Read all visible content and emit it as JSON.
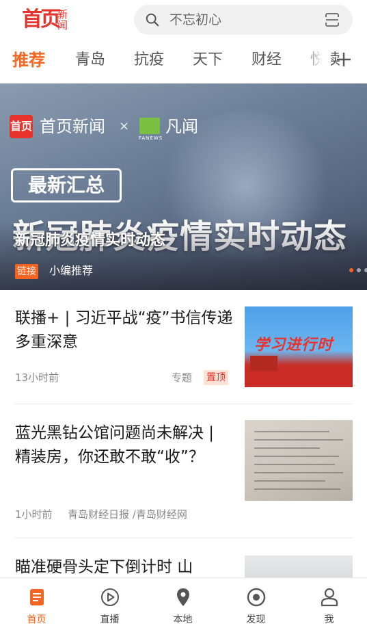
{
  "header": {
    "logo_main": "首页",
    "logo_side": "新闻",
    "search_placeholder": "不忘初心"
  },
  "tabs": [
    {
      "label": "推荐",
      "active": true
    },
    {
      "label": "青岛",
      "active": false
    },
    {
      "label": "抗疫",
      "active": false
    },
    {
      "label": "天下",
      "active": false
    },
    {
      "label": "财经",
      "active": false
    },
    {
      "label": "悦读",
      "active": false
    }
  ],
  "banner": {
    "brand": "首页新闻",
    "logo_mark": "首页",
    "times": "×",
    "partner": "凡闻",
    "partner_sub": "FANEWS",
    "badge": "最新汇总",
    "headline": "新冠肺炎疫情实时动态",
    "tag": "链接",
    "source": "小编推荐",
    "slide_count": 3,
    "active_slide": 1
  },
  "articles": [
    {
      "title": "联播+ | 习近平战“疫”书信传递多重深意",
      "time": "13小时前",
      "label": "专题",
      "pin": "置顶",
      "thumb_text": "学习进行时"
    },
    {
      "title": "蓝光黑钻公馆问题尚未解决 | 精装房，你还敢不敢“收”？",
      "time": "1小时前",
      "source": "青岛财经日报 /青岛财经网"
    },
    {
      "title": "瞄准硬骨头定下倒计时 山"
    }
  ],
  "bottom_nav": [
    {
      "label": "首页",
      "icon": "home-news-icon",
      "active": true
    },
    {
      "label": "直播",
      "icon": "play-icon",
      "active": false
    },
    {
      "label": "本地",
      "icon": "location-pin-icon",
      "active": false
    },
    {
      "label": "发现",
      "icon": "discover-icon",
      "active": false
    },
    {
      "label": "我",
      "icon": "user-icon",
      "active": false
    }
  ],
  "colors": {
    "accent": "#f26522",
    "brand_red": "#e8322c",
    "pin_bg": "#fde1d6"
  }
}
